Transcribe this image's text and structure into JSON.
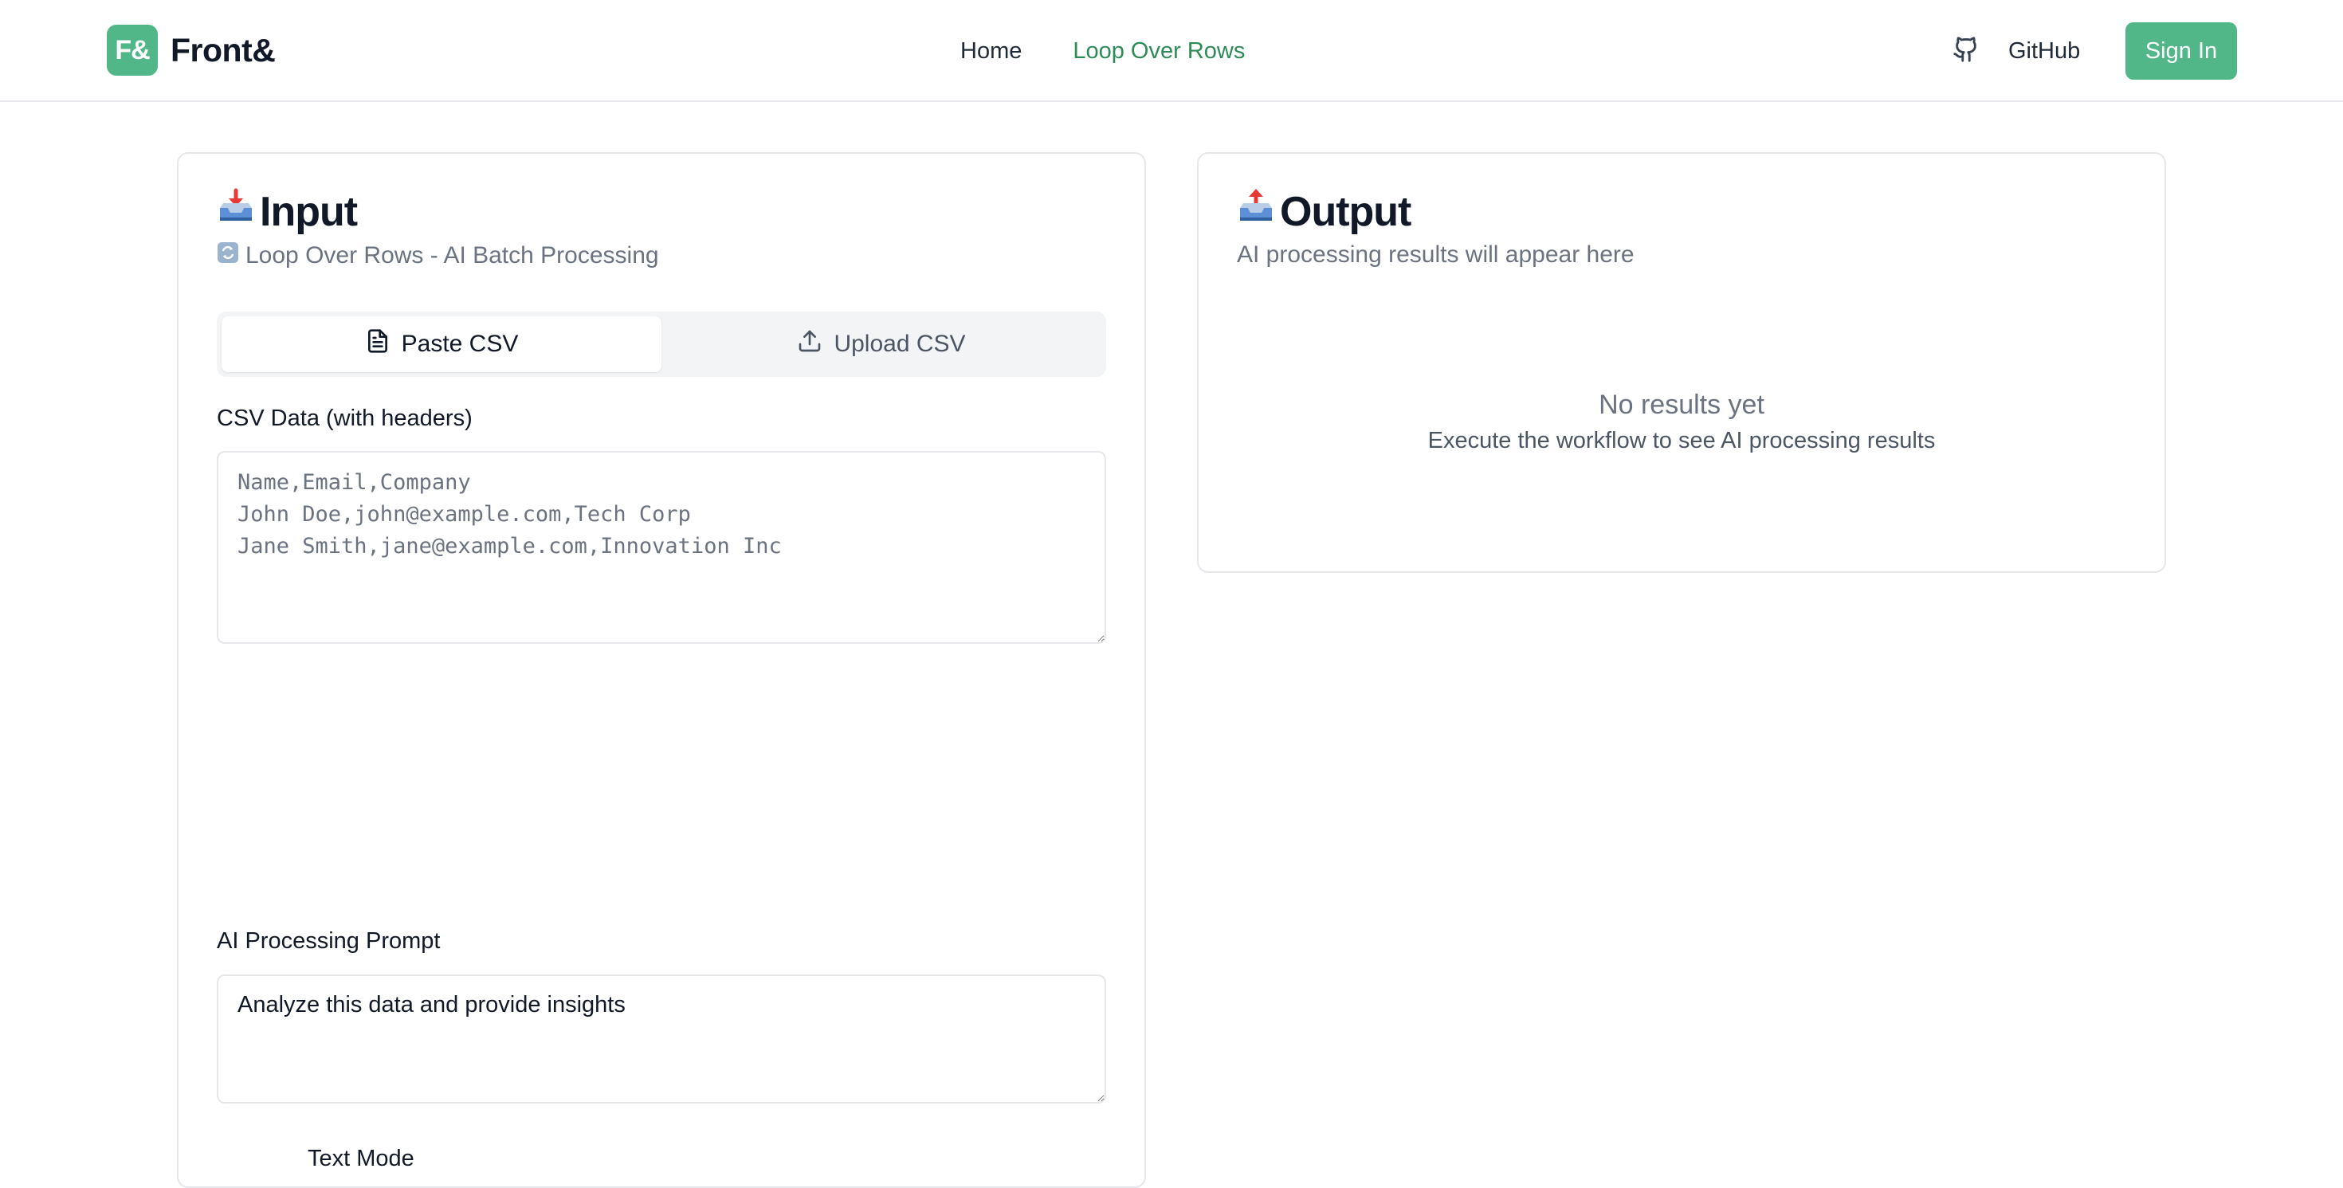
{
  "header": {
    "logo_text": "F&",
    "brand_name": "Front&",
    "nav": [
      {
        "label": "Home"
      },
      {
        "label": "Loop Over Rows"
      }
    ],
    "github_label": "GitHub",
    "github_icon": "github-icon",
    "signin_label": "Sign In",
    "accent_color": "#52b788"
  },
  "input_card": {
    "title": "Input",
    "title_icon": "inbox-tray-icon",
    "subtitle": "Loop Over Rows - AI Batch Processing",
    "subtitle_icon": "loop-arrows-icon",
    "tabs": [
      {
        "label": "Paste CSV",
        "icon": "document-icon",
        "active": true
      },
      {
        "label": "Upload CSV",
        "icon": "upload-icon",
        "active": false
      }
    ],
    "csv_label": "CSV Data (with headers)",
    "csv_placeholder": "Name,Email,Company\nJohn Doe,john@example.com,Tech Corp\nJane Smith,jane@example.com,Innovation Inc",
    "prompt_label": "AI Processing Prompt",
    "prompt_value": "Analyze this data and provide insights",
    "partial_label": "Text Mode"
  },
  "output_card": {
    "title": "Output",
    "title_icon": "outbox-tray-icon",
    "subtitle": "AI processing results will appear here",
    "empty_title": "No results yet",
    "empty_subtitle": "Execute the workflow to see AI processing results"
  }
}
